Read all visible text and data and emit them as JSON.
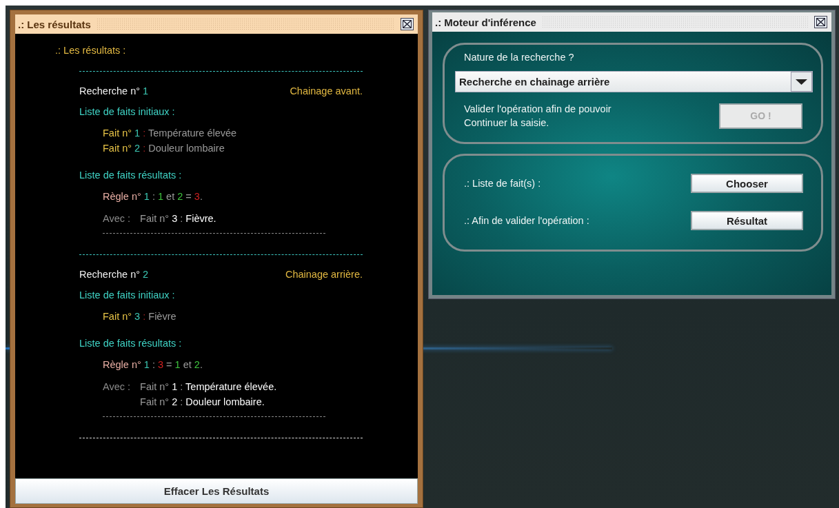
{
  "results_window": {
    "title": ".: Les résultats",
    "heading": ".: Les résultats :",
    "searches": [
      {
        "label": "Recherche n°",
        "number": "1",
        "mode": "Chainage avant.",
        "initial_heading": "Liste de faits initiaux :",
        "initial_facts": [
          {
            "label": "Fait n°",
            "number": "1",
            "separator": ":",
            "text": "Température élevée"
          },
          {
            "label": "Fait n°",
            "number": "2",
            "separator": ":",
            "text": "Douleur lombaire"
          }
        ],
        "result_heading": "Liste de faits résultats :",
        "rule": {
          "label": "Règle n°",
          "number": "1",
          "separator": ":",
          "tokens": [
            {
              "kind": "premise",
              "text": "1"
            },
            {
              "kind": "operator",
              "text": "et"
            },
            {
              "kind": "premise",
              "text": "2"
            },
            {
              "kind": "operator",
              "text": "="
            },
            {
              "kind": "conclusion",
              "text": "3"
            },
            {
              "kind": "operator",
              "text": "."
            }
          ]
        },
        "with_label": "Avec :",
        "result_facts": [
          {
            "label": "Fait n°",
            "number": "3",
            "separator": ":",
            "text": "Fièvre."
          }
        ]
      },
      {
        "label": "Recherche n°",
        "number": "2",
        "mode": "Chainage arrière.",
        "initial_heading": "Liste de faits initiaux :",
        "initial_facts": [
          {
            "label": "Fait n°",
            "number": "3",
            "separator": ":",
            "text": "Fièvre"
          }
        ],
        "result_heading": "Liste de faits résultats :",
        "rule": {
          "label": "Règle n°",
          "number": "1",
          "separator": ":",
          "tokens": [
            {
              "kind": "conclusion",
              "text": "3"
            },
            {
              "kind": "operator",
              "text": "="
            },
            {
              "kind": "premise",
              "text": "1"
            },
            {
              "kind": "operator",
              "text": "et"
            },
            {
              "kind": "premise",
              "text": "2"
            },
            {
              "kind": "operator",
              "text": "."
            }
          ]
        },
        "with_label": "Avec :",
        "result_facts": [
          {
            "label": "Fait n°",
            "number": "1",
            "separator": ":",
            "text": "Température élevée."
          },
          {
            "label": "Fait n°",
            "number": "2",
            "separator": ":",
            "text": "Douleur lombaire."
          }
        ]
      }
    ],
    "clear_button": "Effacer Les Résultats"
  },
  "inference_window": {
    "title": ".: Moteur d'inférence",
    "question": "Nature de la recherche ?",
    "search_type": {
      "value": "Recherche en chainage arrière"
    },
    "validate_text": [
      "Valider l'opération afin de pouvoir",
      "Continuer la saisie."
    ],
    "go_button": {
      "label": "GO !",
      "disabled": true
    },
    "rows": [
      {
        "label": ".: Liste de fait(s) :",
        "button": "Chooser"
      },
      {
        "label": ".: Afin de valider l'opération :",
        "button": "Résultat"
      }
    ]
  }
}
